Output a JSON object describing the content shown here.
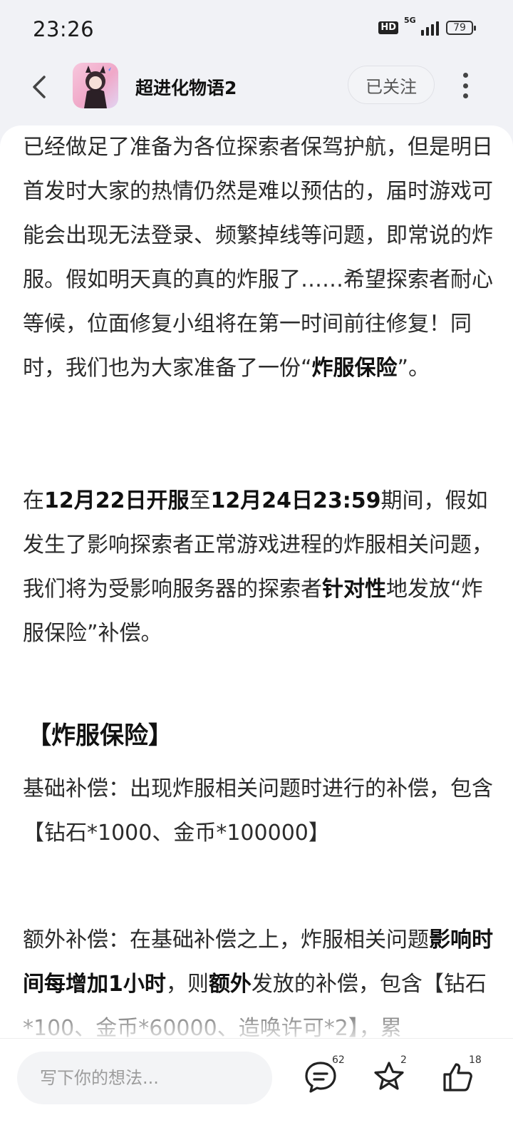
{
  "status_bar": {
    "time": "23:26",
    "hd_label": "HD",
    "network_label": "5G",
    "battery": "79"
  },
  "header": {
    "title": "超进化物语2",
    "follow_label": "已关注",
    "icons": [
      "back-arrow-icon",
      "app-icon",
      "more-vertical-icon"
    ]
  },
  "article": {
    "p1": "已经做足了准备为各位探索者保驾护航，但是明日首发时大家的热情仍然是难以预估的，届时游戏可能会出现无法登录、频繁掉线等问题，即常说的炸服。假如明天真的真的炸服了……希望探索者耐心等候，位面修复小组将在第一时间前往修复！同时，我们也为大家准备了一份“",
    "p1_bold": "炸服保险",
    "p1_end": "”。",
    "p2_a": "在",
    "p2_b1": "12月22日开服",
    "p2_c": "至",
    "p2_b2": "12月24日23:59",
    "p2_d": "期间，假如发生了影响探索者正常游戏进程的炸服相关问题，我们将为受影响服务器的探索者",
    "p2_b3": "针对性",
    "p2_e": "地发放“炸服保险”补偿。",
    "section_title": "【炸服保险】",
    "p3": "基础补偿：出现炸服相关问题时进行的补偿，包含【钻石*1000、金币*100000】",
    "p4_a": "额外补偿：在基础补偿之上，炸服相关问题",
    "p4_b1": "影响时间每增加1小时",
    "p4_c": "，则",
    "p4_b2": "额外",
    "p4_d": "发放的补偿，包含【钻石*100、金币*60000、造唤许可*2】，累"
  },
  "bottom_bar": {
    "placeholder": "写下你的想法...",
    "comment_count": "62",
    "favorite_count": "2",
    "like_count": "18"
  }
}
